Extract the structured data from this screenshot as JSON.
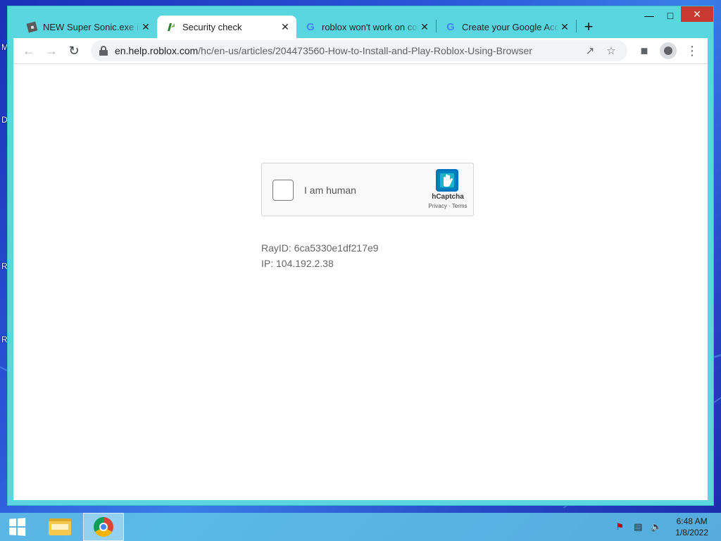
{
  "desktop": {
    "icon_letters": [
      "M",
      "D",
      "R",
      "R"
    ]
  },
  "tabs": [
    {
      "title": "NEW Super Sonic.exe in a",
      "favicon": "roblox-icon"
    },
    {
      "title": "Security check",
      "favicon": "security-icon"
    },
    {
      "title": "roblox won't work on coi",
      "favicon": "google-icon"
    },
    {
      "title": "Create your Google Acco",
      "favicon": "google-icon"
    }
  ],
  "toolbar": {
    "url_host": "en.help.roblox.com",
    "url_path": "/hc/en-us/articles/204473560-How-to-Install-and-Play-Roblox-Using-Browser"
  },
  "captcha": {
    "label": "I am human",
    "brand": "hCaptcha",
    "links": "Privacy · Terms"
  },
  "ray_info": {
    "ray_id": "RayID: 6ca5330e1df217e9",
    "ip": "IP: 104.192.2.38"
  },
  "taskbar": {
    "time": "6:48 AM",
    "date": "1/8/2022"
  },
  "colors": {
    "window_frame": "#5ad6e0",
    "taskbar": "#60c4e6",
    "close_button": "#c8392f"
  }
}
